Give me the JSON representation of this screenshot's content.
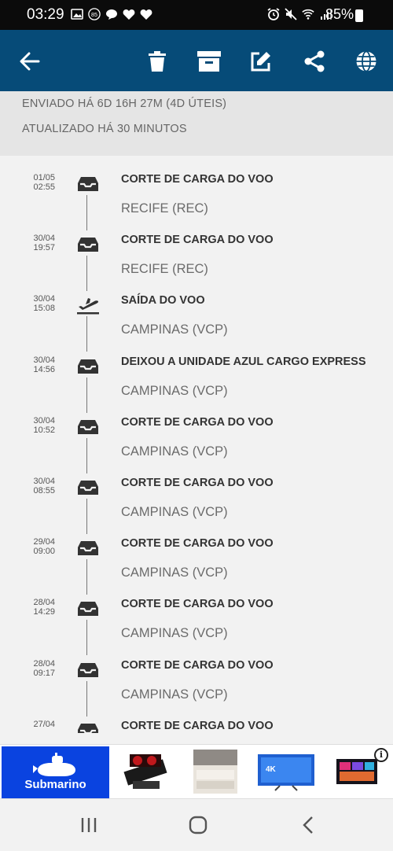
{
  "status_bar": {
    "time": "03:29",
    "battery_percent": "85%",
    "notification_badge": "85"
  },
  "toolbar": {
    "back_icon": "arrow-left-icon",
    "actions": [
      "trash-icon",
      "archive-icon",
      "edit-icon",
      "share-icon",
      "globe-icon"
    ],
    "background_color": "#064b78"
  },
  "summary": {
    "sent": "ENVIADO HÁ 6D 16H 27M (4D ÚTEIS)",
    "updated": "ATUALIZADO HÁ 30 MINUTOS"
  },
  "events": [
    {
      "date": "01/05",
      "time": "02:55",
      "icon": "inbox-tray-icon",
      "title": "CORTE DE CARGA DO VOO",
      "place": "RECIFE (REC)"
    },
    {
      "date": "30/04",
      "time": "19:57",
      "icon": "inbox-tray-icon",
      "title": "CORTE DE CARGA DO VOO",
      "place": "RECIFE (REC)"
    },
    {
      "date": "30/04",
      "time": "15:08",
      "icon": "plane-takeoff-icon",
      "title": "SAÍDA DO VOO",
      "place": "CAMPINAS (VCP)"
    },
    {
      "date": "30/04",
      "time": "14:56",
      "icon": "inbox-tray-icon",
      "title": "DEIXOU A UNIDADE AZUL CARGO EXPRESS",
      "place": "CAMPINAS (VCP)"
    },
    {
      "date": "30/04",
      "time": "10:52",
      "icon": "inbox-tray-icon",
      "title": "CORTE DE CARGA DO VOO",
      "place": "CAMPINAS (VCP)"
    },
    {
      "date": "30/04",
      "time": "08:55",
      "icon": "inbox-tray-icon",
      "title": "CORTE DE CARGA DO VOO",
      "place": "CAMPINAS (VCP)"
    },
    {
      "date": "29/04",
      "time": "09:00",
      "icon": "inbox-tray-icon",
      "title": "CORTE DE CARGA DO VOO",
      "place": "CAMPINAS (VCP)"
    },
    {
      "date": "28/04",
      "time": "14:29",
      "icon": "inbox-tray-icon",
      "title": "CORTE DE CARGA DO VOO",
      "place": "CAMPINAS (VCP)"
    },
    {
      "date": "28/04",
      "time": "09:17",
      "icon": "inbox-tray-icon",
      "title": "CORTE DE CARGA DO VOO",
      "place": "CAMPINAS (VCP)"
    },
    {
      "date": "27/04",
      "time": "",
      "icon": "inbox-tray-icon",
      "title": "CORTE DE CARGA DO VOO",
      "place": ""
    }
  ],
  "ad": {
    "brand": "Submarino",
    "brand_color": "#0a43e0",
    "products": [
      "graphics-card-image",
      "sofa-image",
      "tv-image",
      "smart-tv-image"
    ],
    "tv_badge": "4K"
  },
  "nav": {
    "buttons": [
      "recent-apps-icon",
      "home-icon",
      "back-icon"
    ]
  }
}
